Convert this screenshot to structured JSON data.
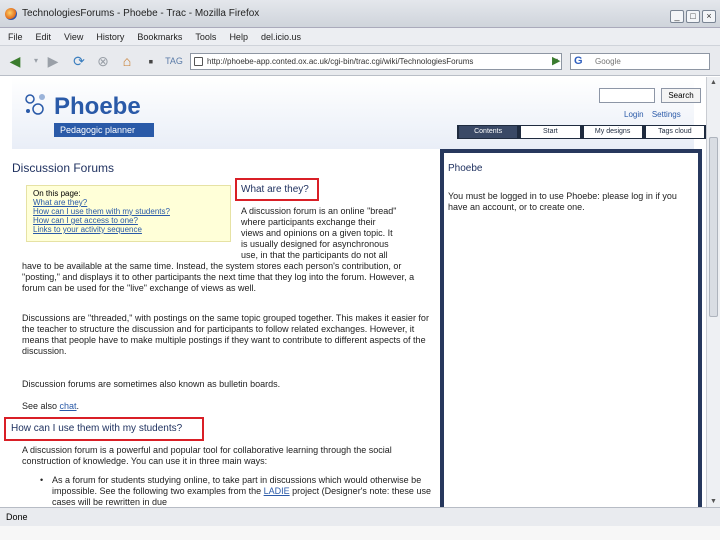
{
  "window": {
    "title": "TechnologiesForums - Phoebe - Trac - Mozilla Firefox",
    "controls": [
      "_",
      "□",
      "×"
    ]
  },
  "menu": [
    "File",
    "Edit",
    "View",
    "History",
    "Bookmarks",
    "Tools",
    "Help",
    "del.icio.us"
  ],
  "toolbar": {
    "url": "http://phoebe-app.conted.ox.ac.uk/cgi-bin/trac.cgi/wiki/TechnologiesForums",
    "search_placeholder": "Google",
    "search_engine": "G"
  },
  "header": {
    "logo_title": "Phoebe",
    "logo_subtitle": "Pedagogic planner",
    "search_button": "Search",
    "links": [
      "Login",
      "Settings"
    ],
    "tabs": [
      {
        "label": "Contents",
        "active": true
      },
      {
        "label": "Start",
        "active": false
      },
      {
        "label": "My designs",
        "active": false
      },
      {
        "label": "Tags cloud",
        "active": false
      }
    ]
  },
  "content": {
    "page_title": "Discussion Forums",
    "toc": {
      "heading": "On this page:",
      "links": [
        "What are they?",
        "How can I use them with my students?",
        "How can I get access to one?",
        "Links to your activity sequence"
      ]
    },
    "section1_heading": "What are they?",
    "section1_lines": [
      "A discussion forum is an online \"bread\"",
      "where participants exchange their",
      "views and opinions on a given topic. It",
      "is usually designed for asynchronous",
      "use, in that the participants do not all"
    ],
    "para1": "have to be available at the same time. Instead, the system stores each person's contribution, or \"posting,\" and displays it to other participants the next time that they log into the forum. However, a forum can be used for the \"live\" exchange of views as well.",
    "para2": "Discussions are \"threaded,\" with postings on the same topic grouped together. This makes it easier for the teacher to structure the discussion and for participants to follow related exchanges. However, it means that people have to make multiple postings if they want to contribute to different aspects of the discussion.",
    "para3": "Discussion forums are sometimes also known as bulletin boards.",
    "see_also_prefix": "See also ",
    "see_also_link": "chat",
    "see_also_suffix": ".",
    "section2_heading": "How can I use them with my students?",
    "para4": "A discussion forum is a powerful and popular tool for collaborative learning through the social construction of knowledge. You can use it in three main ways:",
    "bullet1_text": "As a forum for students studying online, to take part in discussions which would otherwise be impossible. See the following two examples from the",
    "bullet1_link": "LADIE",
    "bullet1_suffix": "project (Designer's note: these use cases will be rewritten in due"
  },
  "sidepanel": {
    "title": "Phoebe",
    "text": "You must be logged in to use Phoebe: please log in if you have an account, or to create one."
  },
  "status": {
    "text": "Done"
  },
  "colors": {
    "accent": "#2a5aa8",
    "highlight": "#d91f26",
    "panel": "#27385d"
  }
}
